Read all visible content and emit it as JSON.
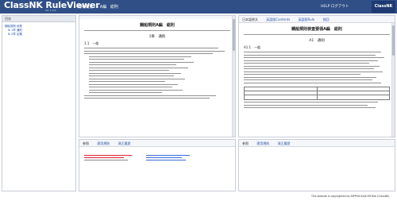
{
  "header": {
    "app_title": "ClassNK RuleViewer",
    "version": "Ver 1.0.0",
    "nav": [
      "▸ 規則閲覧",
      "▸ A編",
      "総則"
    ],
    "user_link": "HELP  ログアウト",
    "badge": "ClassNK",
    "bg_color": "#2f4f86"
  },
  "sidebar": {
    "title": "目次",
    "root": "鋼船規則 総則",
    "items": [
      "1章 通則",
      "2章 定義"
    ]
  },
  "left_doc": {
    "title": "鋼船規則A編　総則",
    "chapter": "1章　通則",
    "section": "1.1　一般",
    "tabs": [
      "参照",
      "適用規則",
      "改正履歴"
    ]
  },
  "right_doc": {
    "toolbar": [
      "日本語原文",
      "英語版Contents",
      "英語版Rule",
      "前回"
    ],
    "title": "鋼船規則検査要領A編　総則",
    "chapter": "A1　通則",
    "section": "A1.1　一般",
    "tabs": [
      "参照",
      "適用規則",
      "改正履歴"
    ]
  },
  "footer": {
    "text": "This website is copyrighted by NIPPON KAIJI KYOKAI (ClassNK)"
  }
}
